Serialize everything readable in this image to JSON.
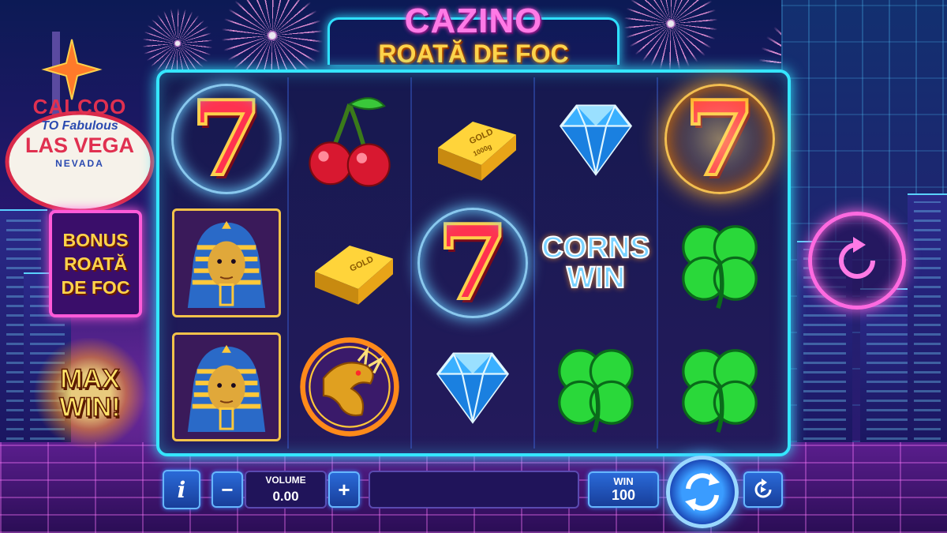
{
  "title": {
    "line1": "CAZINO",
    "line2": "ROATĂ DE FOC"
  },
  "vegas_sign": {
    "line1": "CALCOO",
    "line2": "TO Fabulous",
    "line3": "LAS VEGA",
    "line4": "NEVADA"
  },
  "bonus_panel": {
    "line1": "BONUS",
    "line2": "ROATĂ",
    "line3": "DE FOC"
  },
  "max_win": {
    "line1": "MAX",
    "line2": "WIN!"
  },
  "reels": [
    [
      "seven-electric",
      "pharaoh",
      "pharaoh"
    ],
    [
      "cherry",
      "gold-bar",
      "dragon"
    ],
    [
      "gold-bar",
      "seven-electric",
      "diamond"
    ],
    [
      "diamond",
      "corns-win",
      "clover"
    ],
    [
      "seven-fire",
      "clover",
      "clover"
    ]
  ],
  "symbols": {
    "seven": "7",
    "gold_bar_text": "GOLD",
    "gold_bar_weight": "1000g",
    "corns_line1": "CORNS",
    "corns_line2": "WIN"
  },
  "controls": {
    "info_label": "i",
    "minus_label": "−",
    "plus_label": "+",
    "volume_label": "VOLUME",
    "volume_value": "0.00",
    "message": "",
    "win_label": "WIN",
    "win_value": "100"
  },
  "colors": {
    "neon_cyan": "#35e6ff",
    "neon_pink": "#ff5ad8",
    "gold": "#ffd34a",
    "button_blue": "#2a6ad8"
  },
  "icons": {
    "spin": "spin-arrows-icon",
    "autoplay": "autoplay-icon",
    "side_refresh": "refresh-icon"
  }
}
